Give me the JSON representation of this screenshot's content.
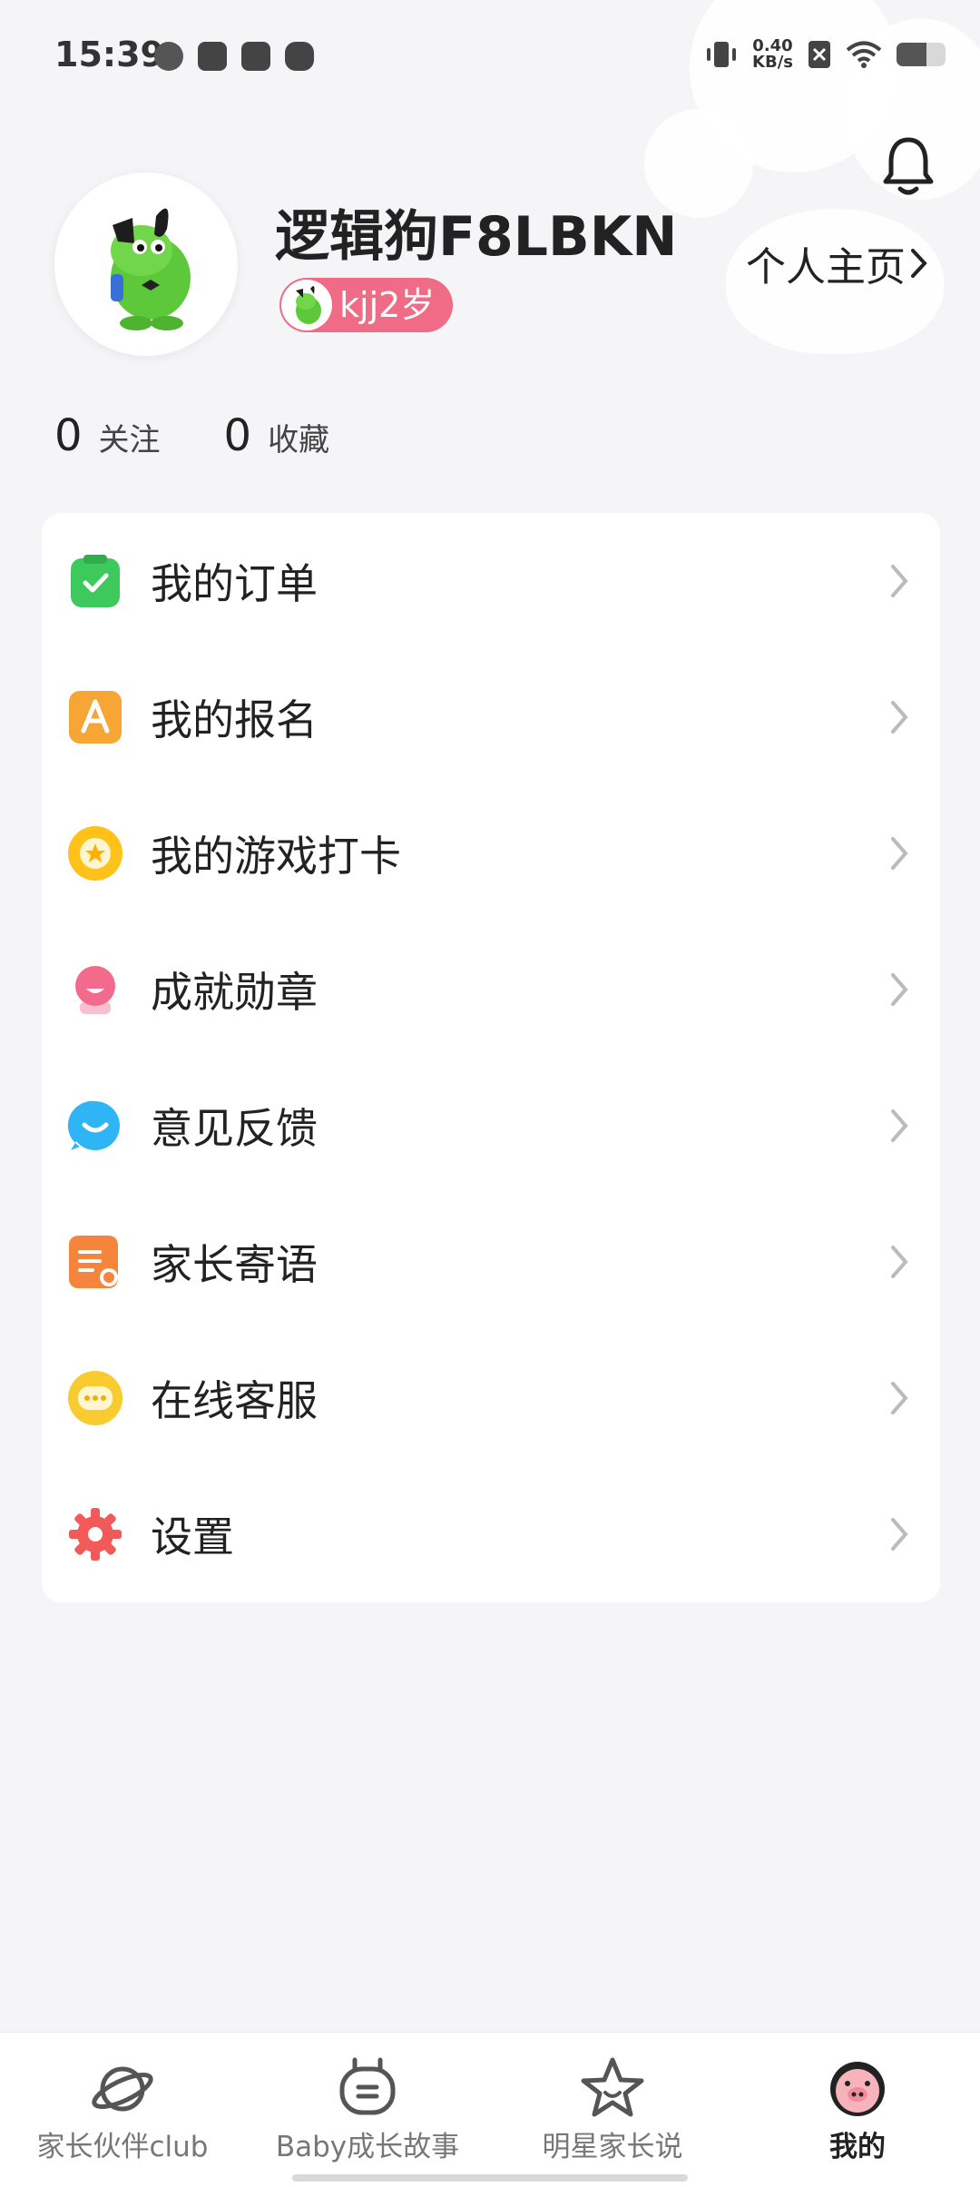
{
  "status_bar": {
    "time": "15:39",
    "net_speed_value": "0.40",
    "net_speed_unit": "KB/s",
    "battery_level": 0.62
  },
  "profile": {
    "username": "逻辑狗F8LBKN",
    "child_badge": "kjj2岁",
    "profile_link": "个人主页",
    "follow_count": "0",
    "follow_label": "关注",
    "favorite_count": "0",
    "favorite_label": "收藏"
  },
  "menu": {
    "items": [
      {
        "label": "我的订单",
        "icon": "order-icon",
        "color": "#3ec95d"
      },
      {
        "label": "我的报名",
        "icon": "signup-icon",
        "color": "#f7a534"
      },
      {
        "label": "我的游戏打卡",
        "icon": "game-checkin-icon",
        "color": "#ffc21a"
      },
      {
        "label": "成就勋章",
        "icon": "medal-icon",
        "color": "#f36b8c"
      },
      {
        "label": "意见反馈",
        "icon": "feedback-icon",
        "color": "#2fb4f5"
      },
      {
        "label": "家长寄语",
        "icon": "parent-message-icon",
        "color": "#f5853c"
      },
      {
        "label": "在线客服",
        "icon": "customer-service-icon",
        "color": "#f8cc2f"
      },
      {
        "label": "设置",
        "icon": "settings-icon",
        "color": "#f25a5a"
      }
    ]
  },
  "tabbar": {
    "tabs": [
      {
        "label": "家长伙伴club",
        "icon": "planet-icon"
      },
      {
        "label": "Baby成长故事",
        "icon": "robot-icon"
      },
      {
        "label": "明星家长说",
        "icon": "star-icon"
      },
      {
        "label": "我的",
        "icon": "pig-face-icon",
        "active": true
      }
    ]
  }
}
